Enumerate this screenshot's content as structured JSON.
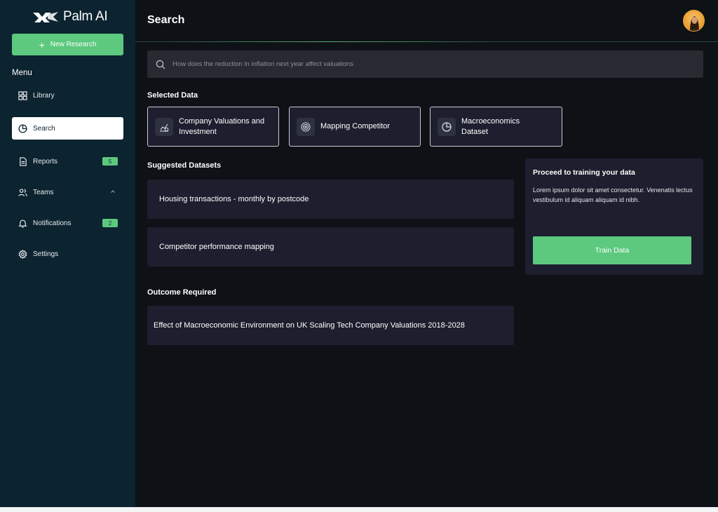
{
  "brand": {
    "name": "Palm AI"
  },
  "sidebar": {
    "new_button": "New Research",
    "menu_label": "Menu",
    "items": [
      {
        "label": "Library",
        "icon": "grid-icon"
      },
      {
        "label": "Search",
        "icon": "pie-chart-icon",
        "active": true
      },
      {
        "label": "Reports",
        "icon": "document-icon",
        "badge": "5"
      },
      {
        "label": "Teams",
        "icon": "users-icon"
      },
      {
        "label": "Notifications",
        "icon": "bell-icon",
        "badge": "2"
      },
      {
        "label": "Settings",
        "icon": "gear-icon"
      }
    ]
  },
  "header": {
    "title": "Search"
  },
  "search": {
    "placeholder": "How does the reduction in inflation next year affect valuations"
  },
  "selected": {
    "title": "Selected Data",
    "cards": [
      {
        "label": "Company Valuations and Investment",
        "icon": "chart-icon"
      },
      {
        "label": "Mapping Competitor",
        "icon": "target-icon"
      },
      {
        "label": "Macroeconomics Dataset",
        "icon": "pie-chart-icon"
      }
    ]
  },
  "suggested": {
    "title": "Suggested Datasets",
    "items": [
      "Housing transactions - monthly by postcode",
      "Competitor performance mapping"
    ]
  },
  "training": {
    "title": "Proceed to training your data",
    "description": "Lorem ipsum dolor sit amet consectetur. Venenatis lectus vestibulum id aliquam aliquam id nibh.",
    "button": "Train Data"
  },
  "outcome": {
    "title": "Outcome Required",
    "text": "Effect of Macroeconomic Environment on UK Scaling Tech Company Valuations 2018-2028"
  },
  "colors": {
    "accent": "#5cc97e",
    "sidebar": "#0c2330",
    "background": "#0e1116",
    "card": "#1d1e2e"
  }
}
